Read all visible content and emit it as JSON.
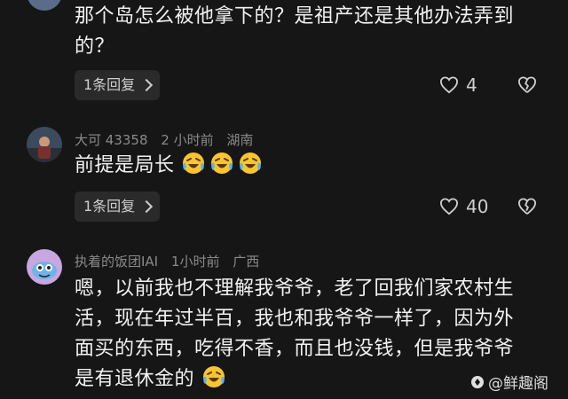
{
  "comments": [
    {
      "text_line1": "那个岛怎么被他拿下的？是祖产还是其他办法弄到",
      "text_line2": "的？",
      "reply_label": "1条回复",
      "like_count": "4"
    },
    {
      "username": "大可 43358",
      "time": "2 小时前",
      "location": "湖南",
      "text": "前提是局长",
      "emoji_count": 3,
      "reply_label": "1条回复",
      "like_count": "40"
    },
    {
      "username": "执着的饭团IAI",
      "time": "1小时前",
      "location": "广西",
      "line1": "嗯，以前我也不理解我爷爷，老了回我们家农村生",
      "line2": "活，现在年过半百，我也和我爷爷一样了，因为外",
      "line3": "面买的东西，吃得不香，而且也没钱，但是我爷爷",
      "line4": "是有退休金的"
    }
  ],
  "watermark": {
    "text": "@鲜趣阁"
  },
  "icons": [
    "heart-outline-icon",
    "broken-heart-icon",
    "laugh-cry-emoji-icon",
    "chevron-right-icon"
  ]
}
